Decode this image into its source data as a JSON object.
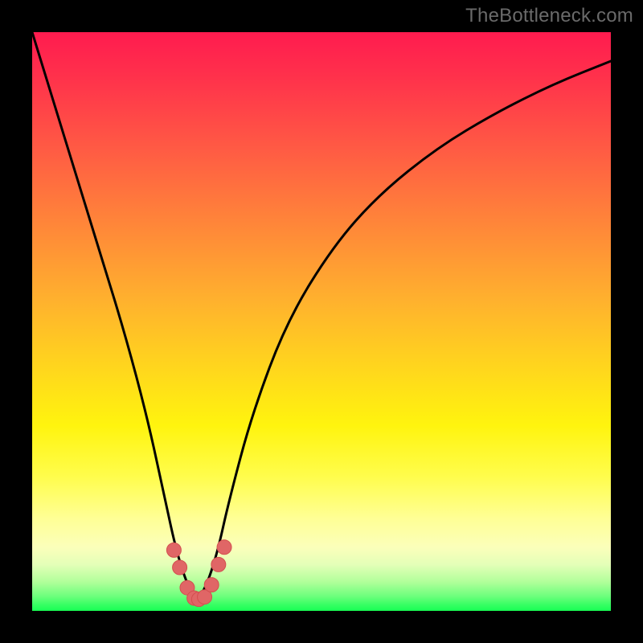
{
  "watermark": "TheBottleneck.com",
  "colors": {
    "curve": "#000000",
    "marker_fill": "#e06666",
    "marker_stroke": "#d34f4f",
    "background_top": "#ff1b4f",
    "background_bottom": "#18ff54",
    "frame": "#000000"
  },
  "chart_data": {
    "type": "line",
    "title": "",
    "xlabel": "",
    "ylabel": "",
    "xlim": [
      0,
      100
    ],
    "ylim": [
      0,
      100
    ],
    "grid": false,
    "legend": false,
    "annotations": [
      "TheBottleneck.com"
    ],
    "series": [
      {
        "name": "bottleneck-curve",
        "x": [
          0,
          4,
          8,
          12,
          16,
          20,
          23,
          25,
          27,
          28.5,
          30,
          32,
          34,
          38,
          44,
          52,
          60,
          70,
          80,
          90,
          100
        ],
        "values": [
          100,
          87,
          74,
          61,
          48,
          33,
          19,
          10,
          4,
          2,
          4,
          10,
          19,
          34,
          50,
          63,
          72,
          80,
          86,
          91,
          95
        ]
      },
      {
        "name": "bottleneck-curve-markers",
        "x": [
          24.5,
          25.5,
          26.8,
          28.0,
          28.8,
          29.8,
          31.0,
          32.2,
          33.2
        ],
        "values": [
          10.5,
          7.5,
          4.0,
          2.2,
          2.0,
          2.4,
          4.5,
          8.0,
          11.0
        ]
      }
    ]
  }
}
